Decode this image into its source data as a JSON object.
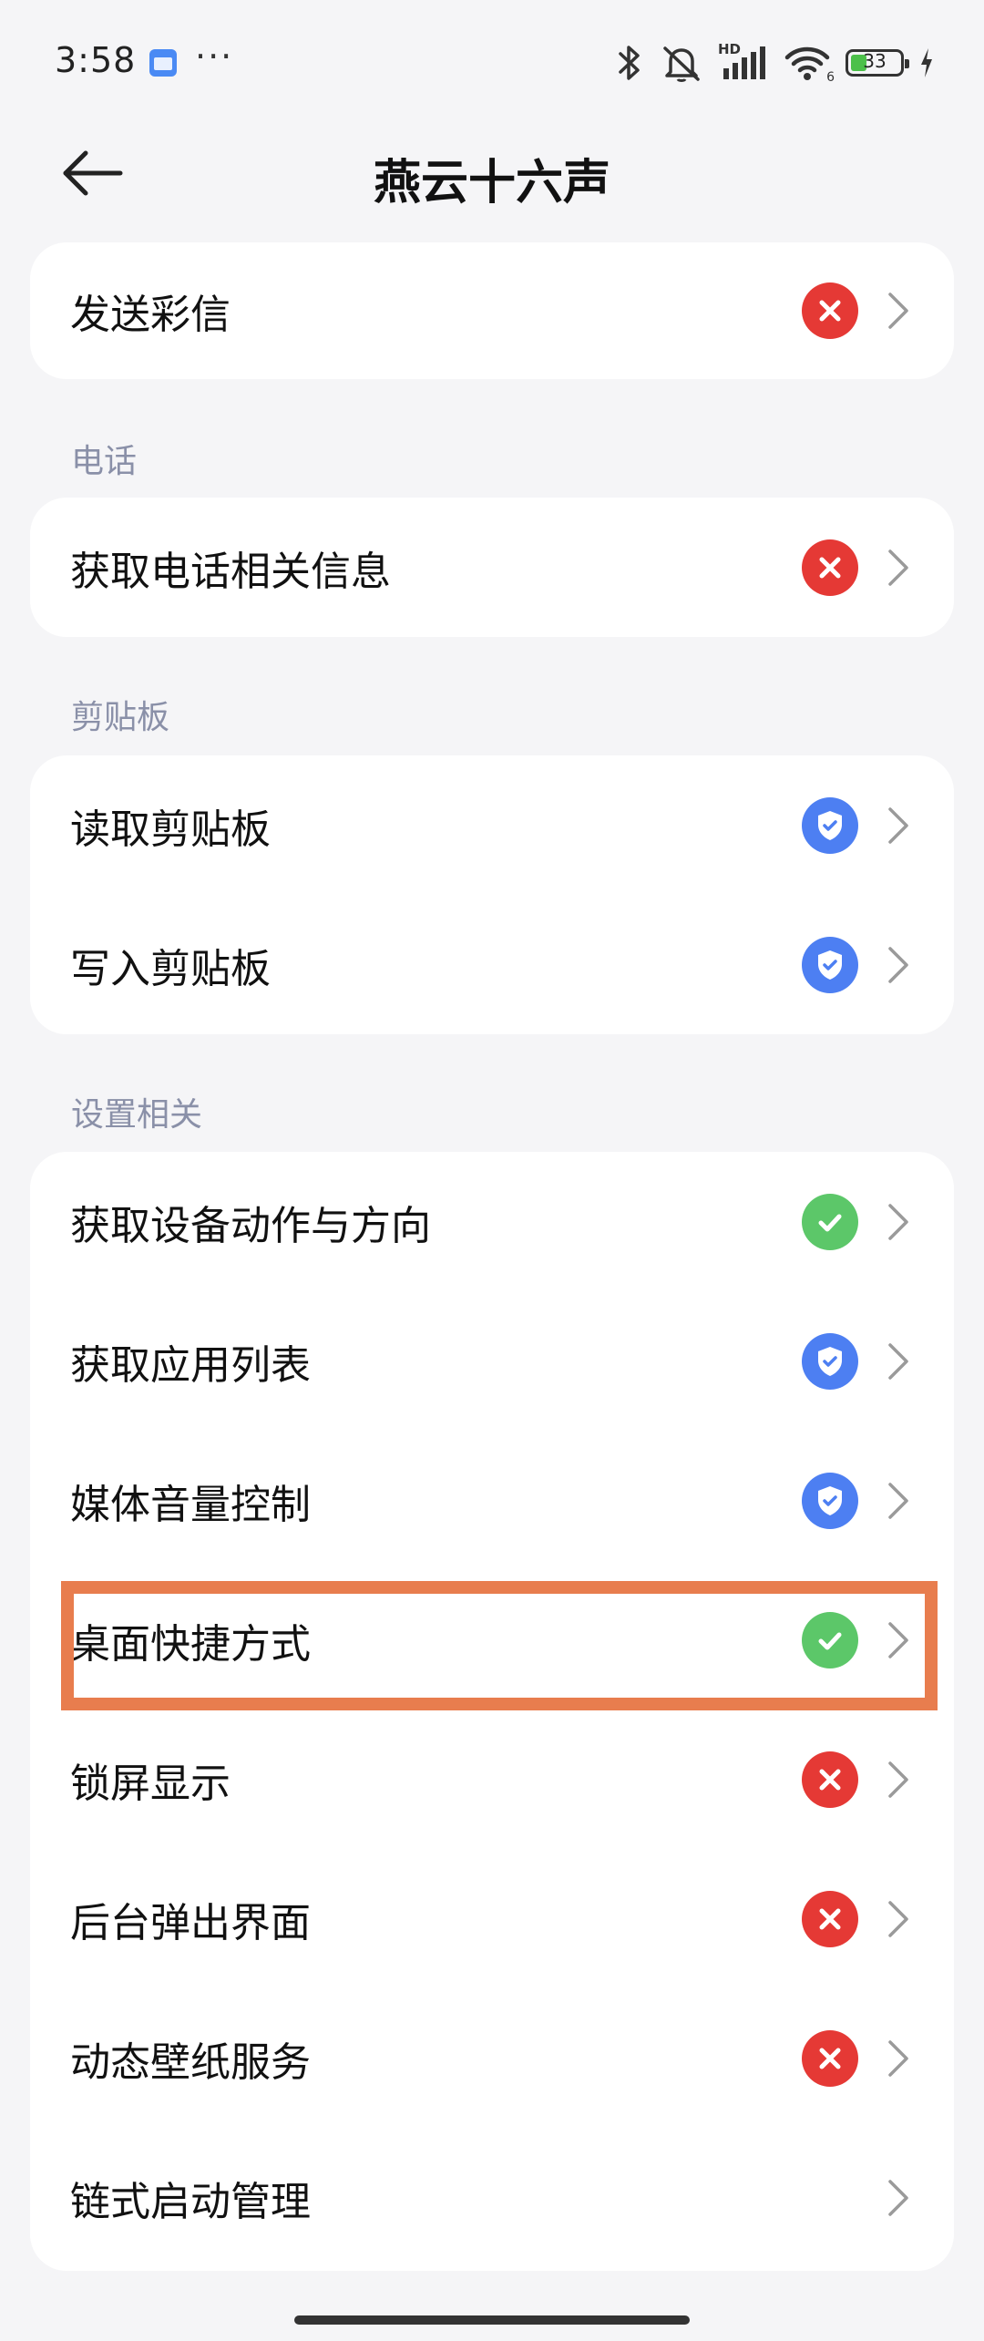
{
  "status_bar": {
    "time": "3:58",
    "more": "···",
    "battery_level": "33",
    "battery_percent": 33,
    "wifi_label": "6",
    "hd_label": "HD"
  },
  "header": {
    "title": "燕云十六声",
    "back_icon": "back-arrow-icon"
  },
  "sections": {
    "messaging": {
      "items": [
        {
          "label": "发送彩信",
          "status": "deny"
        }
      ]
    },
    "phone": {
      "title": "电话",
      "items": [
        {
          "label": "获取电话相关信息",
          "status": "deny"
        }
      ]
    },
    "clipboard": {
      "title": "剪贴板",
      "items": [
        {
          "label": "读取剪贴板",
          "status": "ask"
        },
        {
          "label": "写入剪贴板",
          "status": "ask"
        }
      ]
    },
    "settings": {
      "title": "设置相关",
      "items": [
        {
          "label": "获取设备动作与方向",
          "status": "allow"
        },
        {
          "label": "获取应用列表",
          "status": "ask"
        },
        {
          "label": "媒体音量控制",
          "status": "ask"
        },
        {
          "label": "桌面快捷方式",
          "status": "allow"
        },
        {
          "label": "锁屏显示",
          "status": "deny"
        },
        {
          "label": "后台弹出界面",
          "status": "deny"
        },
        {
          "label": "动态壁纸服务",
          "status": "deny"
        },
        {
          "label": "链式启动管理",
          "status": "none"
        }
      ]
    }
  },
  "colors": {
    "deny": "#e53935",
    "ask": "#4d7ff2",
    "allow": "#5cc769",
    "highlight": "#e87d4e",
    "section_label": "#8a90a8",
    "background": "#f5f5f7"
  }
}
